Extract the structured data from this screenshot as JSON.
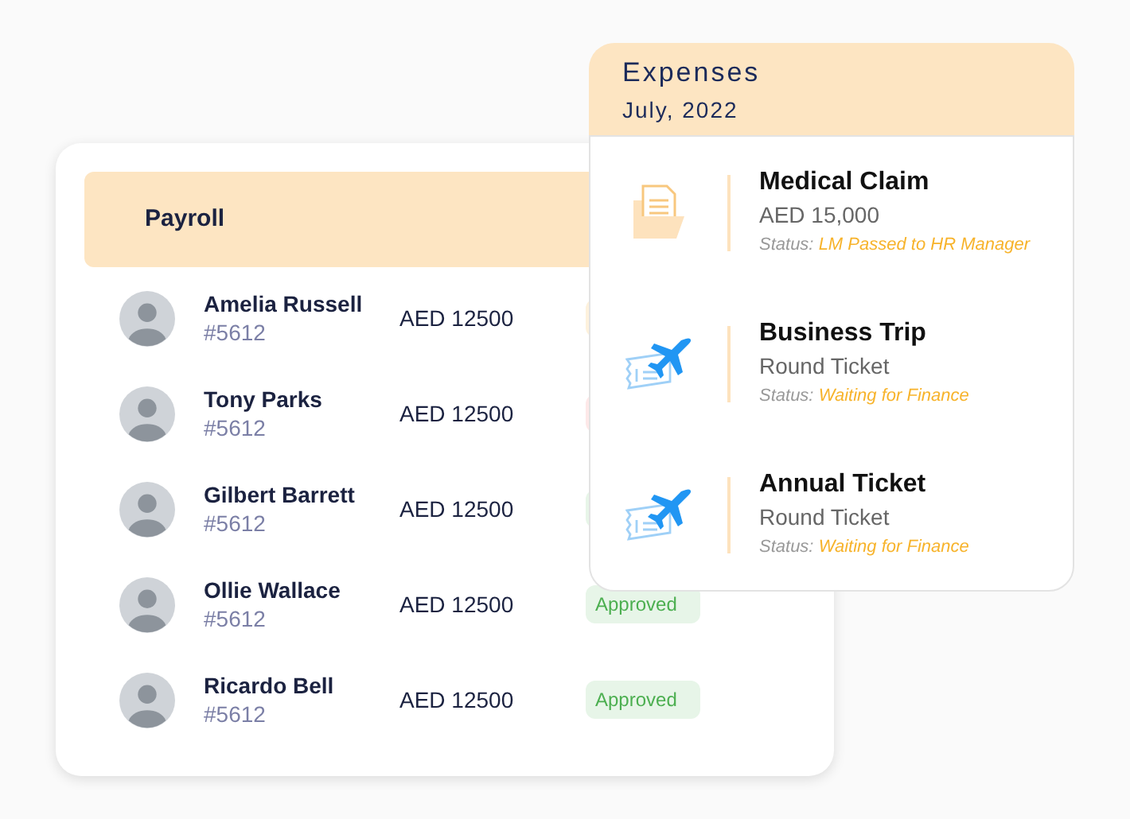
{
  "payroll": {
    "title": "Payroll",
    "rows": [
      {
        "name": "Amelia Russell",
        "id": "#5612",
        "amount": "AED 12500",
        "color": "#fdf1dc"
      },
      {
        "name": "Tony Parks",
        "id": "#5612",
        "amount": "AED 12500",
        "color": "#fde8e8"
      },
      {
        "name": "Gilbert Barrett",
        "id": "#5612",
        "amount": "AED 12500",
        "color": "#e7f5e8"
      },
      {
        "name": "Ollie Wallace",
        "id": "#5612",
        "amount": "AED 12500",
        "status": "Approved",
        "color": "#e7f5e8"
      },
      {
        "name": "Ricardo Bell",
        "id": "#5612",
        "amount": "AED 12500",
        "status": "Approved",
        "color": "#e7f5e8"
      }
    ]
  },
  "expenses": {
    "title": "Expenses",
    "period": "July, 2022",
    "items": [
      {
        "kind": "document",
        "title": "Medical Claim",
        "detail": "AED 15,000",
        "status_label": "Status:",
        "status": "LM Passed to HR Manager"
      },
      {
        "kind": "flight",
        "title": "Business Trip",
        "detail": "Round Ticket",
        "status_label": "Status:",
        "status": "Waiting for Finance"
      },
      {
        "kind": "flight",
        "title": "Annual Ticket",
        "detail": "Round Ticket",
        "status_label": "Status:",
        "status": "Waiting for Finance"
      }
    ]
  }
}
